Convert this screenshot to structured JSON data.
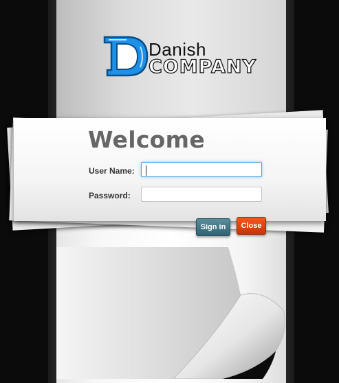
{
  "logo": {
    "line1": "Danish",
    "line2": "COMPANY",
    "icon": "d-monogram-icon",
    "accent_color": "#1e90e8"
  },
  "login": {
    "title": "Welcome",
    "username_label": "User Name:",
    "username_value": "",
    "password_label": "Password:",
    "password_value": "",
    "signin_label": "Sign in",
    "close_label": "Close"
  },
  "colors": {
    "signin_button": "#3b7484",
    "close_button": "#e0461a",
    "focus_border": "#4aa3de",
    "background": "#0b0b0b"
  }
}
